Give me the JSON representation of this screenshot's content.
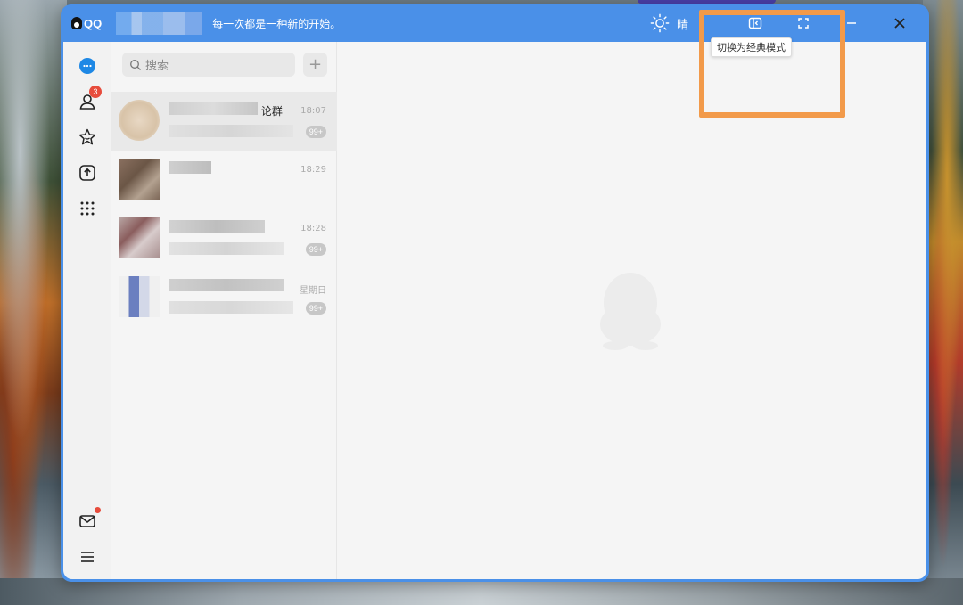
{
  "app": {
    "logo_text": "QQ",
    "signature": "每一次都是一种新的开始。",
    "weather": "晴"
  },
  "tooltip": "切换为经典模式",
  "nav": {
    "contacts_badge": "3"
  },
  "search": {
    "placeholder": "搜索"
  },
  "chats": [
    {
      "name_visible": "论群",
      "time": "18:07",
      "count": "99+",
      "active": true
    },
    {
      "name_visible": "",
      "time": "18:29",
      "count": ""
    },
    {
      "name_visible": "",
      "time": "18:28",
      "count": "99+"
    },
    {
      "name_visible": "",
      "time": "星期日",
      "count": "99+"
    }
  ],
  "colors": {
    "titlebar": "#4a90e8",
    "accent": "#1e88e5",
    "badge": "#e74c3c",
    "highlight": "#f29a4a"
  }
}
